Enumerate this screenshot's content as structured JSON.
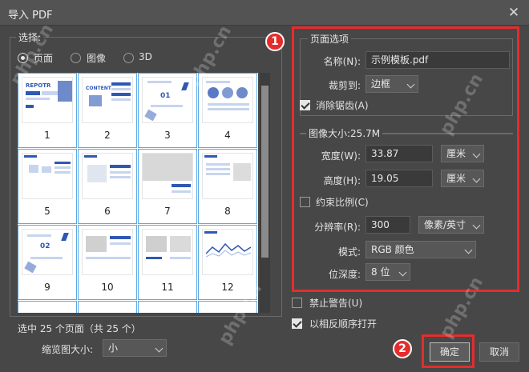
{
  "window": {
    "title": "导入 PDF",
    "close": "✕"
  },
  "select_group": {
    "legend": "选择:",
    "radios": [
      {
        "label": "页面",
        "checked": true
      },
      {
        "label": "图像",
        "checked": false
      },
      {
        "label": "3D",
        "checked": false
      }
    ]
  },
  "thumbnails": [
    "1",
    "2",
    "3",
    "4",
    "5",
    "6",
    "7",
    "8",
    "9",
    "10",
    "11",
    "12"
  ],
  "thumb_text": {
    "t1a": "REPOTR",
    "t2a": "CONTENT",
    "t3a": "01",
    "t9a": "02"
  },
  "selection_status": "选中 25 个页面（共 25 个）",
  "thumb_size": {
    "label": "缩览图大小:",
    "value": "小"
  },
  "page_options": {
    "legend": "页面选项",
    "name_label": "名称(N):",
    "name_value": "示例模板.pdf",
    "crop_label": "裁剪到:",
    "crop_value": "边框",
    "antialias_label": "消除锯齿(A)",
    "antialias_checked": true
  },
  "image_size": {
    "legend": "图像大小:25.7M",
    "width_label": "宽度(W):",
    "width_value": "33.87",
    "width_unit": "厘米",
    "height_label": "高度(H):",
    "height_value": "19.05",
    "height_unit": "厘米",
    "constrain_label": "约束比例(C)",
    "constrain_checked": false,
    "resolution_label": "分辨率(R):",
    "resolution_value": "300",
    "resolution_unit": "像素/英寸",
    "mode_label": "模式:",
    "mode_value": "RGB 颜色",
    "depth_label": "位深度:",
    "depth_value": "8 位"
  },
  "options": {
    "suppress_label": "禁止警告(U)",
    "suppress_checked": false,
    "reverse_label": "以相反顺序打开",
    "reverse_checked": true
  },
  "buttons": {
    "ok": "确定",
    "cancel": "取消"
  },
  "annotations": {
    "badge1": "1",
    "badge2": "2"
  },
  "watermark": "php.cn",
  "colors": {
    "accent_red": "#e52c2c",
    "thumb_border": "#5aa9e6",
    "slide_blue": "#2f58b5"
  }
}
